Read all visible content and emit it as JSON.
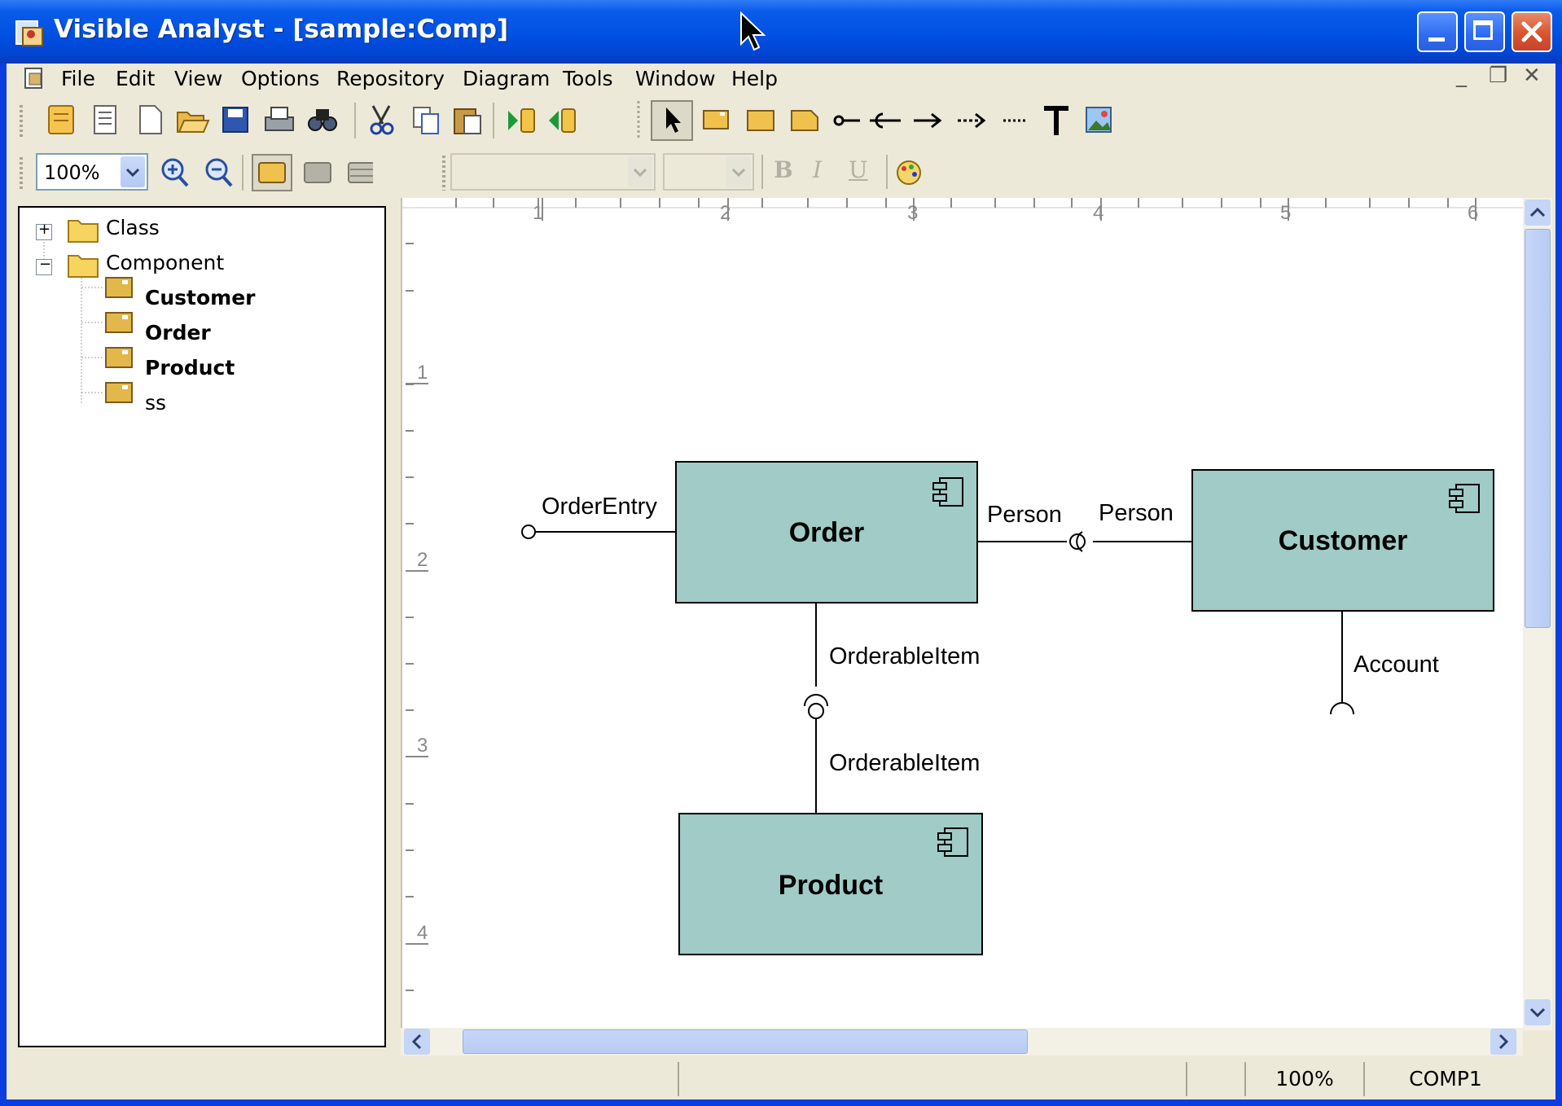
{
  "window": {
    "title": "Visible Analyst - [sample:Comp]",
    "colors": {
      "titlebar": "#0050e3",
      "component_fill": "#a0cbc7",
      "canvas": "#ffffff"
    }
  },
  "menubar": {
    "items": [
      "File",
      "Edit",
      "View",
      "Options",
      "Repository",
      "Diagram",
      "Tools",
      "Window",
      "Help"
    ]
  },
  "toolbar_main": {
    "icons": [
      "new-repository-icon",
      "document-list-icon",
      "new-document-icon",
      "open-folder-icon",
      "save-icon",
      "print-icon",
      "find-icon",
      "cut-icon",
      "copy-icon",
      "paste-icon",
      "import-icon",
      "export-icon",
      "pointer-tool-icon",
      "component-tool-icon",
      "package-tool-icon",
      "note-tool-icon",
      "lollipop-tool-icon",
      "socket-tool-icon",
      "dependency-arrow-icon",
      "dashed-arrow-icon",
      "dotted-line-icon",
      "text-tool-icon",
      "image-tool-icon"
    ]
  },
  "toolbar_format": {
    "zoom_value": "100%",
    "font_combo": "",
    "size_combo": "",
    "bold": "B",
    "italic": "I",
    "underline": "U"
  },
  "tree": {
    "nodes": [
      {
        "label": "Class",
        "expander": "+",
        "type": "folder",
        "bold": false
      },
      {
        "label": "Component",
        "expander": "−",
        "type": "folder",
        "bold": false
      },
      {
        "label": "Customer",
        "type": "component",
        "bold": true
      },
      {
        "label": "Order",
        "type": "component",
        "bold": true
      },
      {
        "label": "Product",
        "type": "component",
        "bold": true
      },
      {
        "label": "ss",
        "type": "component",
        "bold": false
      }
    ]
  },
  "ruler": {
    "horizontal": [
      "1",
      "2",
      "3",
      "4",
      "5",
      "6"
    ],
    "vertical": [
      "1",
      "2",
      "3",
      "4"
    ]
  },
  "diagram": {
    "components": {
      "order": "Order",
      "customer": "Customer",
      "product": "Product"
    },
    "interfaces": {
      "order_entry": "OrderEntry",
      "person_provided": "Person",
      "person_required": "Person",
      "orderable_item_required": "OrderableItem",
      "orderable_item_provided": "OrderableItem",
      "account": "Account"
    }
  },
  "statusbar": {
    "zoom": "100%",
    "diagram": "COMP1"
  }
}
